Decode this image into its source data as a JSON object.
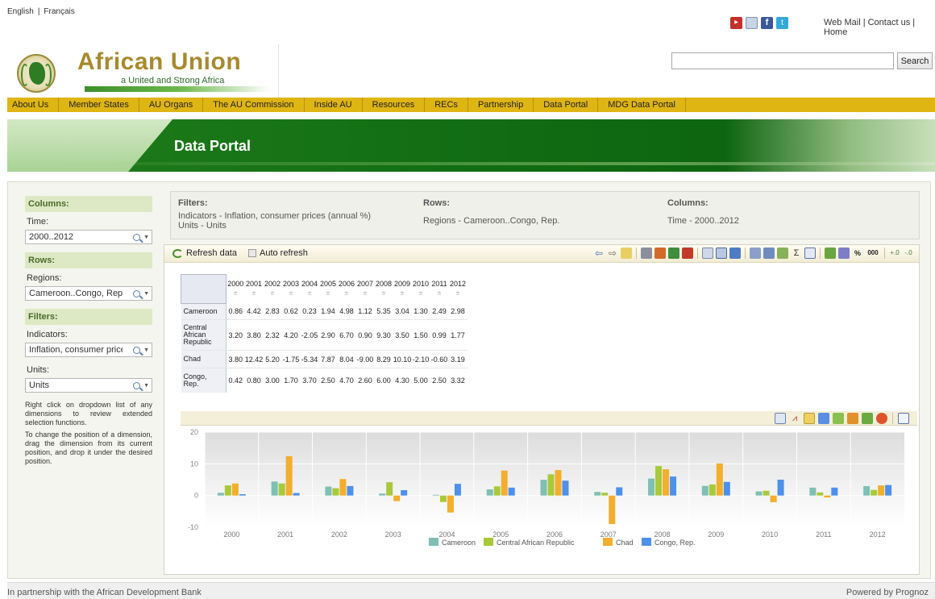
{
  "lang": {
    "english": "English",
    "separator": "|",
    "french": "Français"
  },
  "social": {
    "icons": [
      "youtube-icon",
      "mail-icon",
      "facebook-icon",
      "twitter-icon"
    ]
  },
  "toplinks": "Web Mail | Contact us | Home",
  "logo": {
    "title": "African Union",
    "tagline": "a United and Strong Africa"
  },
  "search": {
    "value": "",
    "button": "Search"
  },
  "nav": [
    "About Us",
    "Member States",
    "AU Organs",
    "The AU Commission",
    "Inside AU",
    "Resources",
    "RECs",
    "Partnership",
    "Data Portal",
    "MDG Data Portal"
  ],
  "banner": {
    "title": "Data Portal"
  },
  "sidebar": {
    "columns_head": "Columns:",
    "time_label": "Time:",
    "time_value": "2000..2012",
    "rows_head": "Rows:",
    "regions_label": "Regions:",
    "regions_value": "Cameroon..Congo, Rep.",
    "filters_head": "Filters:",
    "indicators_label": "Indicators:",
    "indicators_value": "Inflation, consumer price",
    "units_label": "Units:",
    "units_value": "Units",
    "note1": "Right click on dropdown list of any dimensions to review extended selection functions.",
    "note2": "To change the position of a dimension, drag the dimension from its current position, and drop it under the desired position."
  },
  "info": {
    "filters_head": "Filters:",
    "filters_line1": "Indicators - Inflation, consumer prices (annual %)",
    "filters_line2": "Units - Units",
    "rows_head": "Rows:",
    "rows_text": "Regions - Cameroon..Congo, Rep.",
    "columns_head": "Columns:",
    "columns_text": "Time - 2000..2012"
  },
  "toolbar": {
    "refresh": "Refresh data",
    "auto_refresh": "Auto refresh",
    "percent": "%",
    "thousands": "000"
  },
  "table": {
    "years": [
      "2000",
      "2001",
      "2002",
      "2003",
      "2004",
      "2005",
      "2006",
      "2007",
      "2008",
      "2009",
      "2010",
      "2011",
      "2012"
    ],
    "filter_glyph": "⩧",
    "rows": [
      {
        "region": "Cameroon",
        "values": [
          "0.86",
          "4.42",
          "2.83",
          "0.62",
          "0.23",
          "1.94",
          "4.98",
          "1.12",
          "5.35",
          "3.04",
          "1.30",
          "2.49",
          "2.98"
        ]
      },
      {
        "region": "Central African Republic",
        "values": [
          "3.20",
          "3.80",
          "2.32",
          "4.20",
          "-2.05",
          "2.90",
          "6.70",
          "0.90",
          "9.30",
          "3.50",
          "1.50",
          "0.99",
          "1.77"
        ]
      },
      {
        "region": "Chad",
        "values": [
          "3.80",
          "12.42",
          "5.20",
          "-1.75",
          "-5.34",
          "7.87",
          "8.04",
          "-9.00",
          "8.29",
          "10.10",
          "-2.10",
          "-0.60",
          "3.19"
        ]
      },
      {
        "region": "Congo, Rep.",
        "values": [
          "0.42",
          "0.80",
          "3.00",
          "1.70",
          "3.70",
          "2.50",
          "4.70",
          "2.60",
          "6.00",
          "4.30",
          "5.00",
          "2.50",
          "3.32"
        ]
      }
    ]
  },
  "chart_data": {
    "type": "bar",
    "categories": [
      "2000",
      "2001",
      "2002",
      "2003",
      "2004",
      "2005",
      "2006",
      "2007",
      "2008",
      "2009",
      "2010",
      "2011",
      "2012"
    ],
    "series": [
      {
        "name": "Cameroon",
        "color": "#7fbfb4",
        "values": [
          0.86,
          4.42,
          2.83,
          0.62,
          0.23,
          1.94,
          4.98,
          1.12,
          5.35,
          3.04,
          1.3,
          2.49,
          2.98
        ]
      },
      {
        "name": "Central African Republic",
        "color": "#a8c93a",
        "values": [
          3.2,
          3.8,
          2.32,
          4.2,
          -2.05,
          2.9,
          6.7,
          0.9,
          9.3,
          3.5,
          1.5,
          0.99,
          1.77
        ]
      },
      {
        "name": "Chad",
        "color": "#f2ae2c",
        "values": [
          3.8,
          12.42,
          5.2,
          -1.75,
          -5.34,
          7.87,
          8.04,
          -9.0,
          8.29,
          10.1,
          -2.1,
          -0.6,
          3.19
        ]
      },
      {
        "name": "Congo, Rep.",
        "color": "#4e90ea",
        "values": [
          0.42,
          0.8,
          3.0,
          1.7,
          3.7,
          2.5,
          4.7,
          2.6,
          6.0,
          4.3,
          5.0,
          2.5,
          3.32
        ]
      }
    ],
    "yticks": [
      20,
      10,
      0,
      -10
    ],
    "ylim": [
      -10,
      20
    ],
    "legend": "bottom",
    "title": "",
    "xlabel": "",
    "ylabel": ""
  },
  "footer": {
    "left": "In partnership with the African Development Bank",
    "right": "Powered by Prognoz"
  }
}
